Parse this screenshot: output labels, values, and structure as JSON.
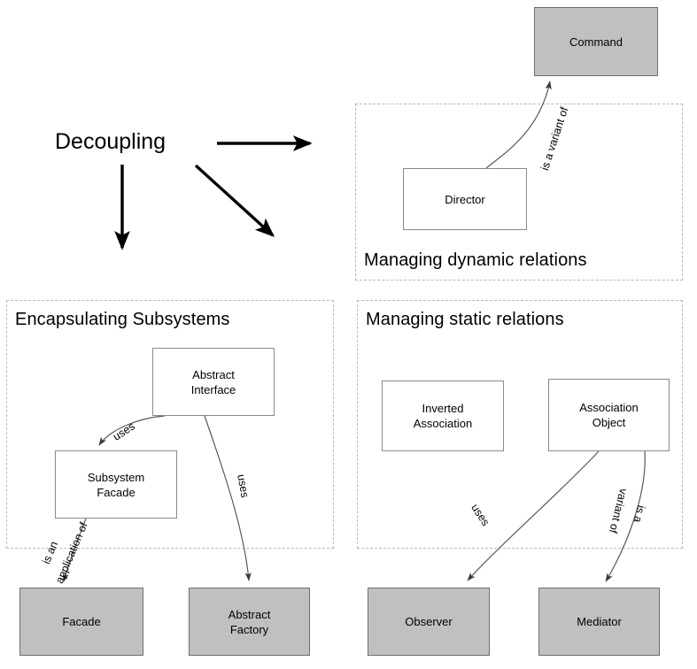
{
  "diagram": {
    "root_label": "Decoupling",
    "groups": [
      {
        "id": "dynamic",
        "title": "Managing dynamic relations"
      },
      {
        "id": "encapsulating",
        "title": "Encapsulating Subsystems"
      },
      {
        "id": "static",
        "title": "Managing static relations"
      }
    ],
    "nodes": [
      {
        "id": "command",
        "label": "Command",
        "style": "shaded"
      },
      {
        "id": "director",
        "label": "Director",
        "style": "plain"
      },
      {
        "id": "abstract-interface",
        "label": "Abstract\nInterface",
        "style": "plain"
      },
      {
        "id": "subsystem-facade",
        "label": "Subsystem\nFacade",
        "style": "plain"
      },
      {
        "id": "facade",
        "label": "Facade",
        "style": "shaded"
      },
      {
        "id": "abstract-factory",
        "label": "Abstract\nFactory",
        "style": "shaded"
      },
      {
        "id": "inverted-association",
        "label": "Inverted\nAssociation",
        "style": "plain"
      },
      {
        "id": "association-object",
        "label": "Association\nObject",
        "style": "plain"
      },
      {
        "id": "observer",
        "label": "Observer",
        "style": "shaded"
      },
      {
        "id": "mediator",
        "label": "Mediator",
        "style": "shaded"
      }
    ],
    "edge_labels": {
      "director_command": "is a variant of",
      "interface_facade": "uses",
      "interface_factory": "uses",
      "subsystem_facade_line1": "is an",
      "subsystem_facade_line2": "application of",
      "assoc_observer": "uses",
      "assoc_mediator_line1": "variant of",
      "assoc_mediator_line2": "is a"
    },
    "colors": {
      "shaded_fill": "#c0c0c0",
      "node_stroke": "#8a8a8a",
      "group_stroke": "#b8b8b8",
      "edge_stroke": "#595959",
      "thick_arrow": "#000000",
      "text": "#000000"
    }
  }
}
